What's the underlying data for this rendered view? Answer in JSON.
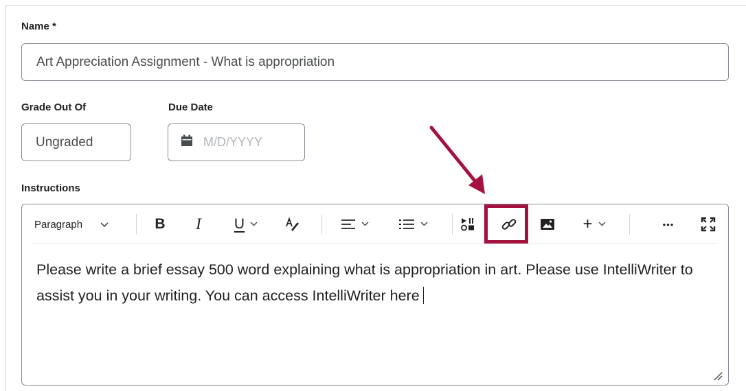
{
  "fields": {
    "name_label": "Name *",
    "name_value": "Art Appreciation Assignment - What is appropriation",
    "grade_label": "Grade Out Of",
    "grade_value": "Ungraded",
    "due_label": "Due Date",
    "due_placeholder": "M/D/YYYY",
    "instructions_label": "Instructions"
  },
  "toolbar": {
    "paragraph_label": "Paragraph",
    "bold_label": "B",
    "italic_label": "I",
    "underline_label": "U",
    "insert_label": "+",
    "more_label": "•••",
    "icons": [
      "chevron-down-icon",
      "bold-icon",
      "italic-icon",
      "underline-icon",
      "format-icon",
      "align-icon",
      "list-icon",
      "media-icon",
      "link-icon",
      "image-icon",
      "insert-icon",
      "more-icon",
      "fullscreen-icon"
    ]
  },
  "editor": {
    "text": "Please write a brief essay 500 word explaining what is appropriation in art. Please use IntelliWriter to assist you in your writing. You can access IntelliWriter here"
  },
  "colors": {
    "highlight": "#a4123f",
    "border": "#868c95",
    "placeholder": "#b2b5b9"
  }
}
